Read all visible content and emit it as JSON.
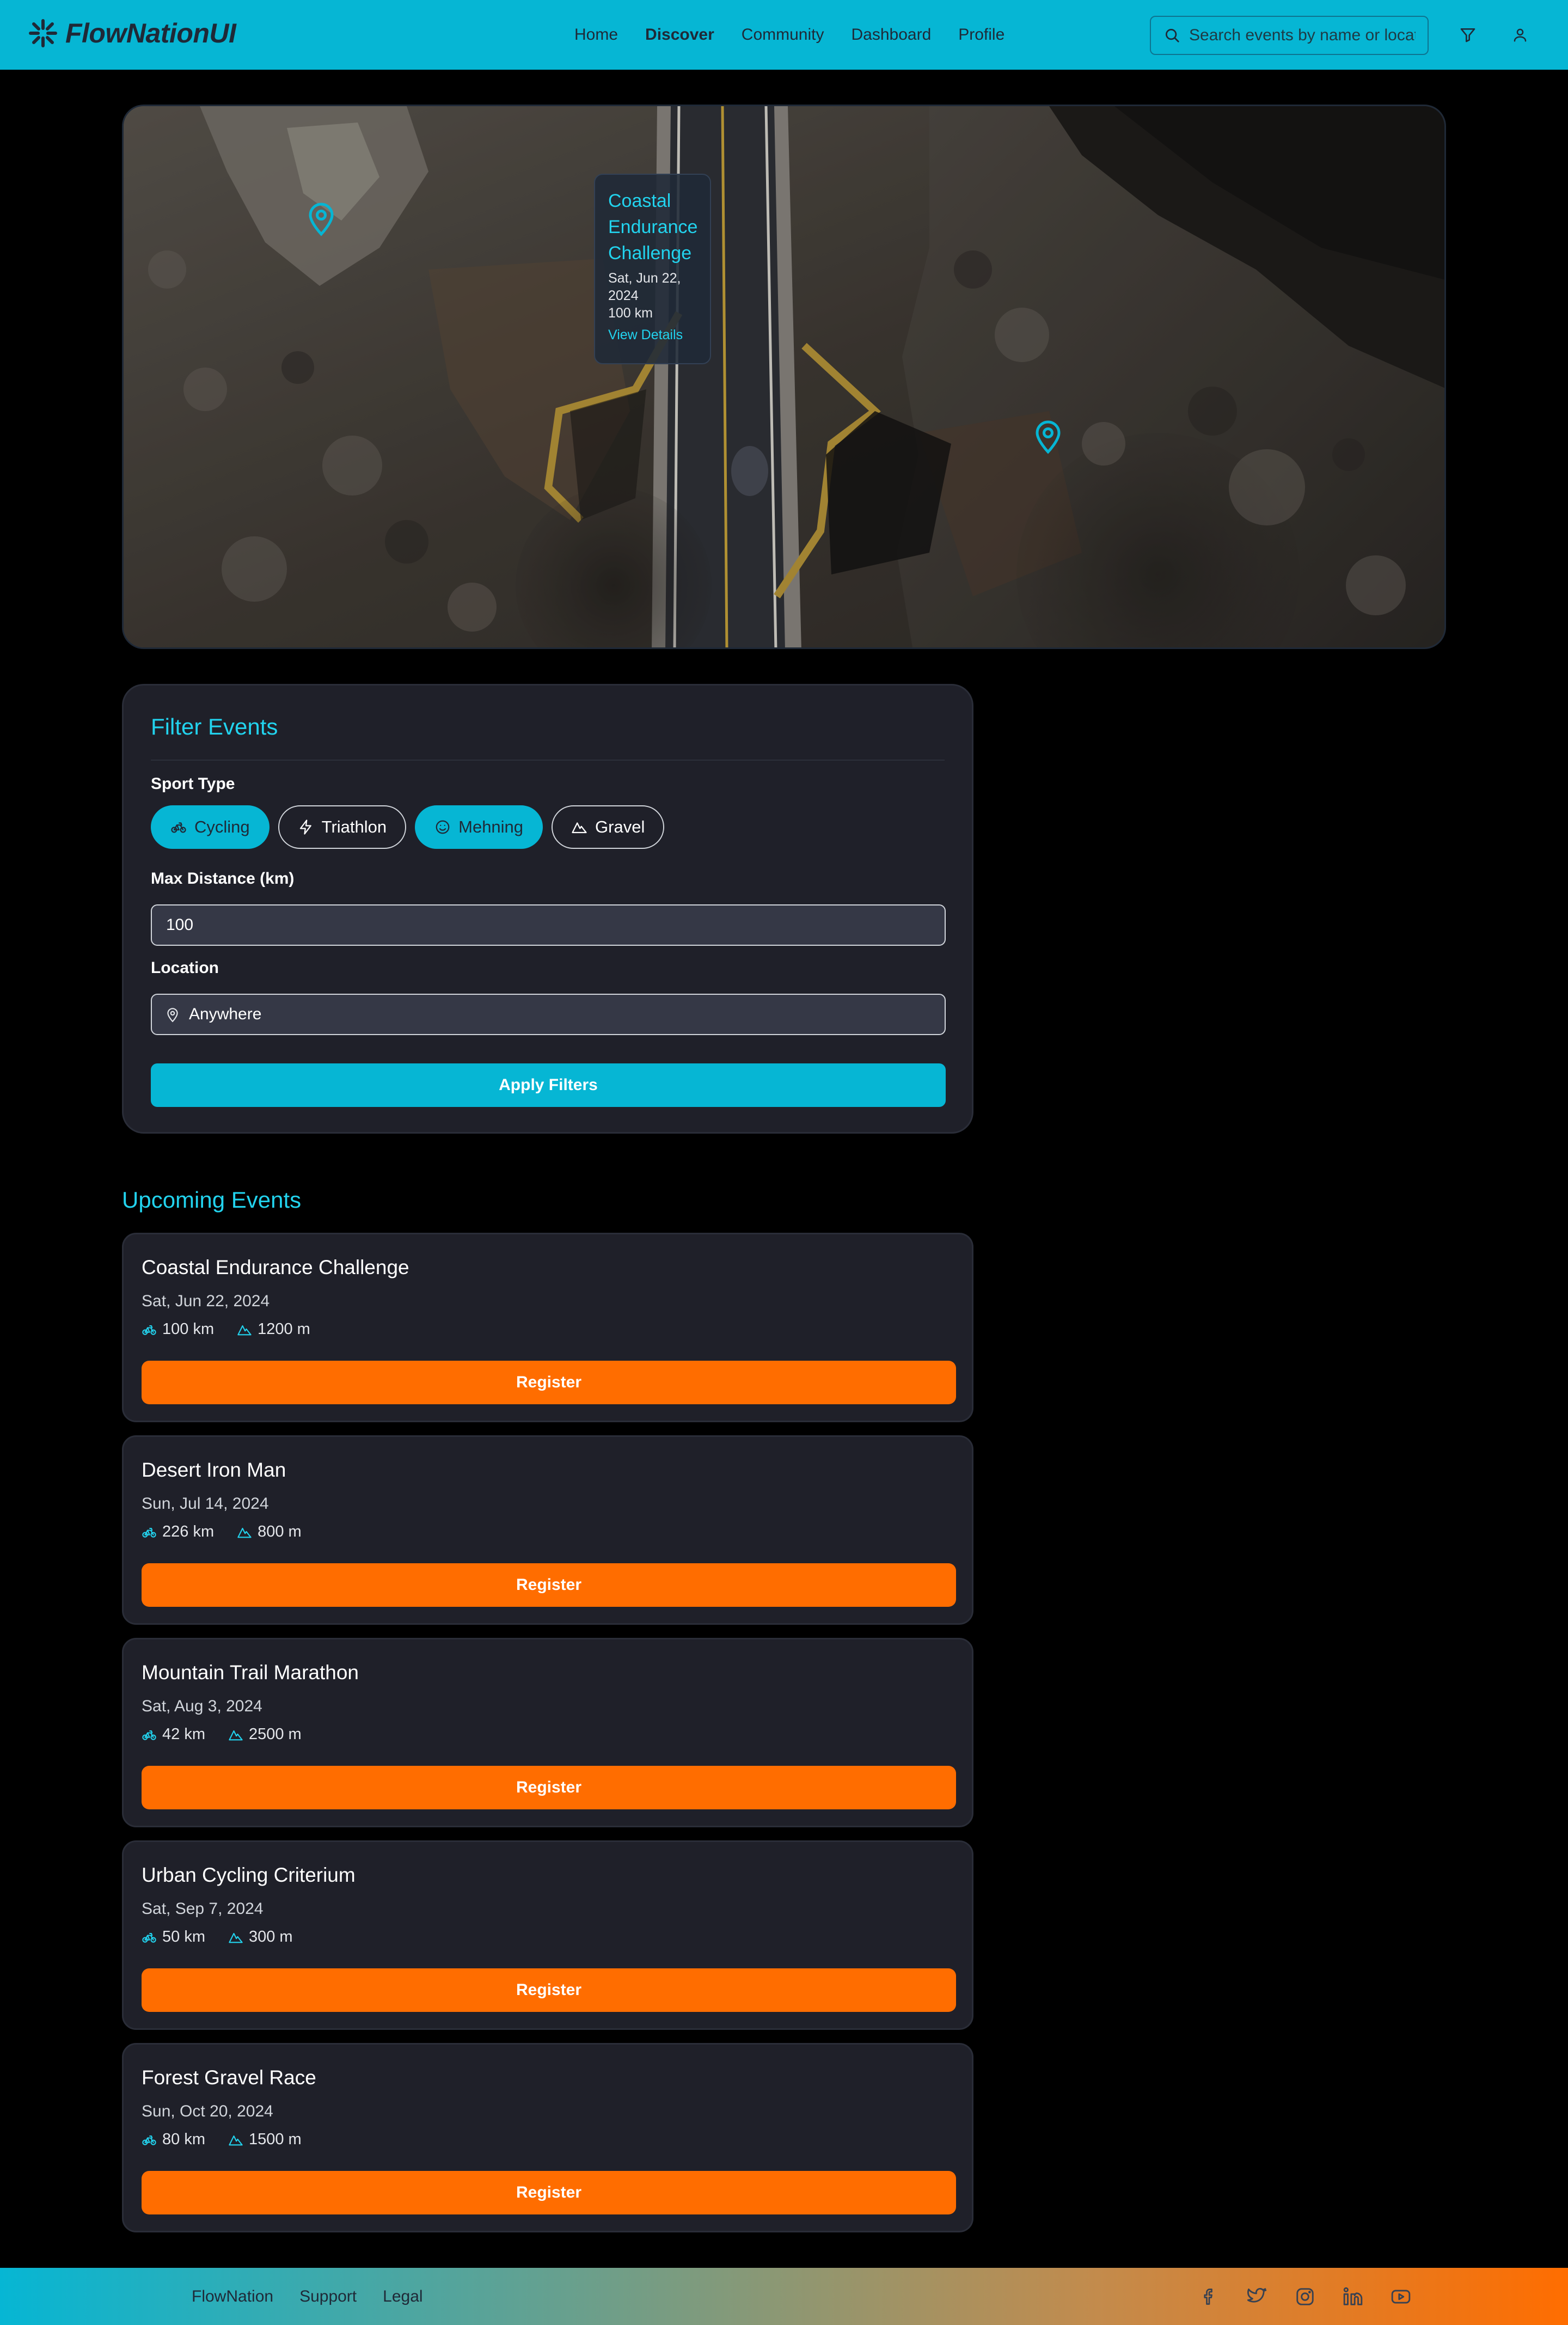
{
  "header": {
    "brand": "FlowNationUI",
    "nav": [
      {
        "label": "Home"
      },
      {
        "label": "Discover"
      },
      {
        "label": "Community"
      },
      {
        "label": "Dashboard"
      },
      {
        "label": "Profile"
      }
    ],
    "active_nav": "Discover",
    "search_placeholder": "Search events by name or location",
    "icons": [
      "search-icon",
      "filter-icon",
      "user-icon"
    ]
  },
  "map": {
    "popup": {
      "title_lines": [
        "Coastal",
        "Endurance",
        "Challenge"
      ],
      "date_lines": [
        "Sat, Jun 22,",
        "2024"
      ],
      "distance": "100 km",
      "link": "View Details"
    },
    "marker_count": 2
  },
  "filter": {
    "title": "Filter Events",
    "sport_type_label": "Sport Type",
    "sports": [
      {
        "label": "Cycling",
        "icon": "bike-icon",
        "selected": true
      },
      {
        "label": "Triathlon",
        "icon": "lightning-icon",
        "selected": false
      },
      {
        "label": "Mehning",
        "icon": "smile-icon",
        "selected": true
      },
      {
        "label": "Gravel",
        "icon": "mountain-icon",
        "selected": false
      }
    ],
    "max_distance_label": "Max Distance (km)",
    "max_distance_value": "100",
    "location_label": "Location",
    "location_value": "Anywhere",
    "apply_label": "Apply Filters"
  },
  "events": {
    "title": "Upcoming Events",
    "register_label": "Register",
    "items": [
      {
        "name": "Coastal Endurance Challenge",
        "date": "Sat, Jun 22, 2024",
        "distance": "100 km",
        "elevation": "1200 m"
      },
      {
        "name": "Desert Iron Man",
        "date": "Sun, Jul 14, 2024",
        "distance": "226 km",
        "elevation": "800 m"
      },
      {
        "name": "Mountain Trail Marathon",
        "date": "Sat, Aug 3, 2024",
        "distance": "42 km",
        "elevation": "2500 m"
      },
      {
        "name": "Urban Cycling Criterium",
        "date": "Sat, Sep 7, 2024",
        "distance": "50 km",
        "elevation": "300 m"
      },
      {
        "name": "Forest Gravel Race",
        "date": "Sun, Oct 20, 2024",
        "distance": "80 km",
        "elevation": "1500 m"
      }
    ]
  },
  "footer": {
    "links": [
      {
        "label": "FlowNation"
      },
      {
        "label": "Support"
      },
      {
        "label": "Legal"
      }
    ],
    "socials": [
      "facebook-icon",
      "twitter-icon",
      "instagram-icon",
      "linkedin-icon",
      "youtube-icon"
    ]
  },
  "colors": {
    "accent": "#06b6d4",
    "cta": "#ff6d00",
    "background": "#000000",
    "card": "#1f2029"
  }
}
